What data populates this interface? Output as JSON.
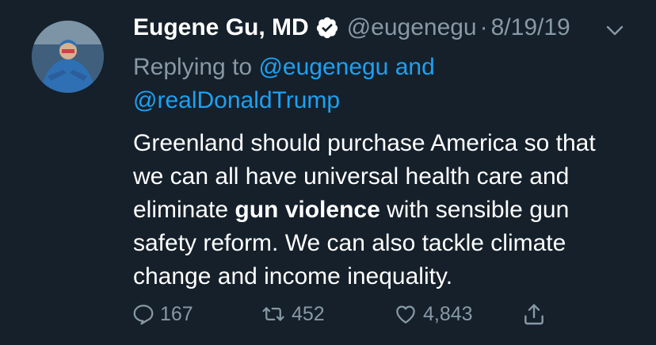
{
  "tweet": {
    "author_name": "Eugene Gu, MD",
    "handle": "@eugenegu",
    "separator": "·",
    "date": "8/19/19",
    "replying_prefix": "Replying to",
    "reply_to_1": "@eugenegu",
    "reply_and": "and",
    "reply_to_2": "@realDonaldTrump",
    "body_part1": "Greenland should purchase America so that we can all have universal health care and eliminate ",
    "body_bold": "gun violence",
    "body_part2": " with sensible gun safety reform. We can also tackle climate change and income inequality."
  },
  "actions": {
    "replies": "167",
    "retweets": "452",
    "likes": "4,843"
  },
  "icons": {
    "verified": "verified-badge-icon",
    "menu": "chevron-down-icon",
    "reply": "reply-icon",
    "retweet": "retweet-icon",
    "like": "heart-icon",
    "share": "share-icon"
  },
  "colors": {
    "background": "#15202b",
    "secondary_text": "#8899a6",
    "link": "#1da1f2"
  }
}
